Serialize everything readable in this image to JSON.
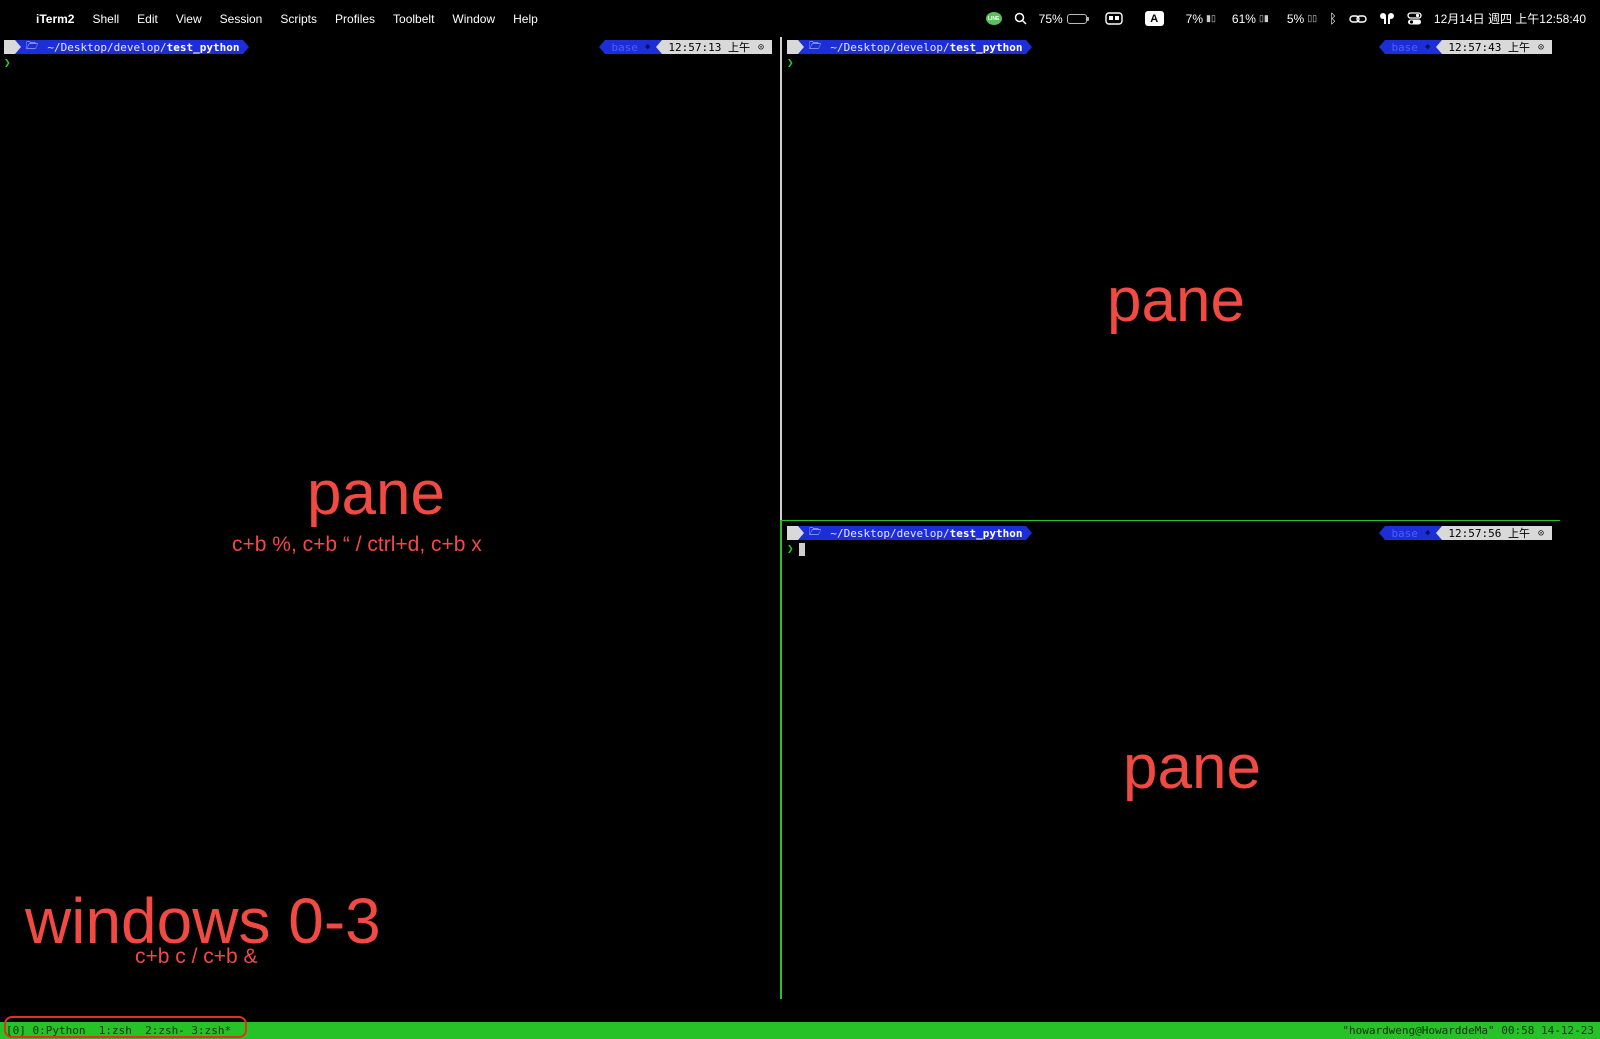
{
  "menubar": {
    "app_name": "iTerm2",
    "menus": [
      "Shell",
      "Edit",
      "View",
      "Session",
      "Scripts",
      "Profiles",
      "Toolbelt",
      "Window",
      "Help"
    ],
    "line_label": "LINE",
    "battery_percent": "75%",
    "battery_level": 0.75,
    "input_source": "A",
    "cpu_percent": "7%",
    "mem_percent": "61%",
    "disk_percent": "5%",
    "datetime": "12月14日 週四 上午12:58:40"
  },
  "panes": {
    "left": {
      "dir_prefix": "~/Desktop/develop/",
      "dir_name": "test_python",
      "env": "base",
      "time": "12:57:13 上午",
      "caret": "❯"
    },
    "top_right": {
      "dir_prefix": "~/Desktop/develop/",
      "dir_name": "test_python",
      "env": "base",
      "time": "12:57:43 上午",
      "caret": "❯"
    },
    "bottom_right": {
      "dir_prefix": "~/Desktop/develop/",
      "dir_name": "test_python",
      "env": "base",
      "time": "12:57:56 上午",
      "caret": "❯"
    }
  },
  "annotations": {
    "pane_left": "pane",
    "keys_left": "c+b %, c+b “ / ctrl+d, c+b x",
    "pane_top_right": "pane",
    "pane_bottom_right": "pane",
    "windows": "windows 0-3",
    "windows_keys": "c+b c /  c+b &"
  },
  "tmux": {
    "left_status": "[0] 0:Python  1:zsh  2:zsh- 3:zsh*",
    "right_status": "\"howardweng@HowarddeMa\" 00:58 14-12-23"
  },
  "colors": {
    "annotation": "#f04a42",
    "tmux_bar": "#27c227",
    "prompt_dir_bg": "#1c2fd6",
    "prompt_light_bg": "#d9d9d9"
  }
}
